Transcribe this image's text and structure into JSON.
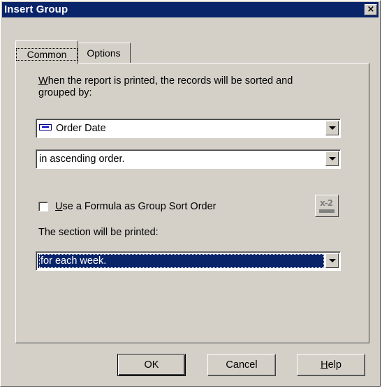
{
  "window": {
    "title": "Insert Group",
    "close_label": "×"
  },
  "tabs": [
    {
      "label": "Common",
      "active": true
    },
    {
      "label": "Options",
      "active": false
    }
  ],
  "common": {
    "sort_description_line1": "When the report is printed, the records will be sorted and",
    "sort_description_line2": "grouped by:",
    "group_field": {
      "value": "Order Date",
      "icon": "database-field-icon"
    },
    "sort_order": {
      "value": "in ascending order."
    },
    "formula_checkbox": {
      "label": "Use a Formula as Group Sort Order",
      "checked": false
    },
    "formula_button_icon": "formula-editor-icon",
    "formula_button_glyph": "x-2",
    "section_label": "The section will be printed:",
    "print_frequency": {
      "value": "for each week."
    }
  },
  "buttons": {
    "ok": "OK",
    "cancel": "Cancel",
    "help": "Help"
  },
  "colors": {
    "titlebar": "#0a246a",
    "dialog_face": "#d4d0c8",
    "selection": "#0a246a"
  }
}
